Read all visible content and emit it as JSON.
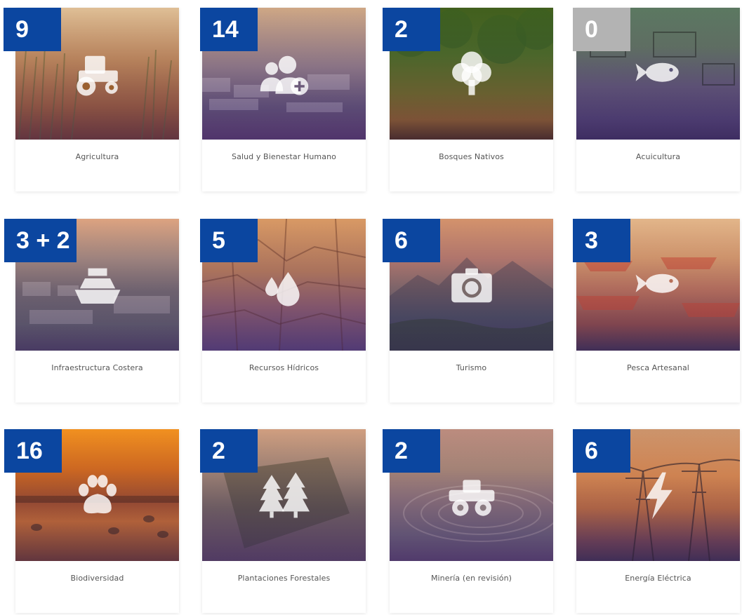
{
  "cards": [
    {
      "label": "Agricultura",
      "count": "9",
      "icon": "tractor-icon"
    },
    {
      "label": "Salud y Bienestar Humano",
      "count": "14",
      "icon": "people-plus-icon"
    },
    {
      "label": "Bosques Nativos",
      "count": "2",
      "icon": "tree-icon"
    },
    {
      "label": "Acuicultura",
      "count": "0",
      "icon": "fish-icon"
    },
    {
      "label": "Infraestructura Costera",
      "count": "3 + 2",
      "icon": "ship-icon"
    },
    {
      "label": "Recursos Hídricos",
      "count": "5",
      "icon": "water-drops-icon"
    },
    {
      "label": "Turismo",
      "count": "6",
      "icon": "camera-icon"
    },
    {
      "label": "Pesca Artesanal",
      "count": "3",
      "icon": "fish-icon"
    },
    {
      "label": "Biodiversidad",
      "count": "16",
      "icon": "paw-icon"
    },
    {
      "label": "Plantaciones Forestales",
      "count": "2",
      "icon": "pine-trees-icon"
    },
    {
      "label": "Minería (en revisión)",
      "count": "2",
      "icon": "truck-icon"
    },
    {
      "label": "Energía Eléctrica",
      "count": "6",
      "icon": "lightning-icon"
    }
  ],
  "colors": {
    "badge": "#0b46a0",
    "badge_zero": "#b3b3b3",
    "label_text": "#555555"
  }
}
